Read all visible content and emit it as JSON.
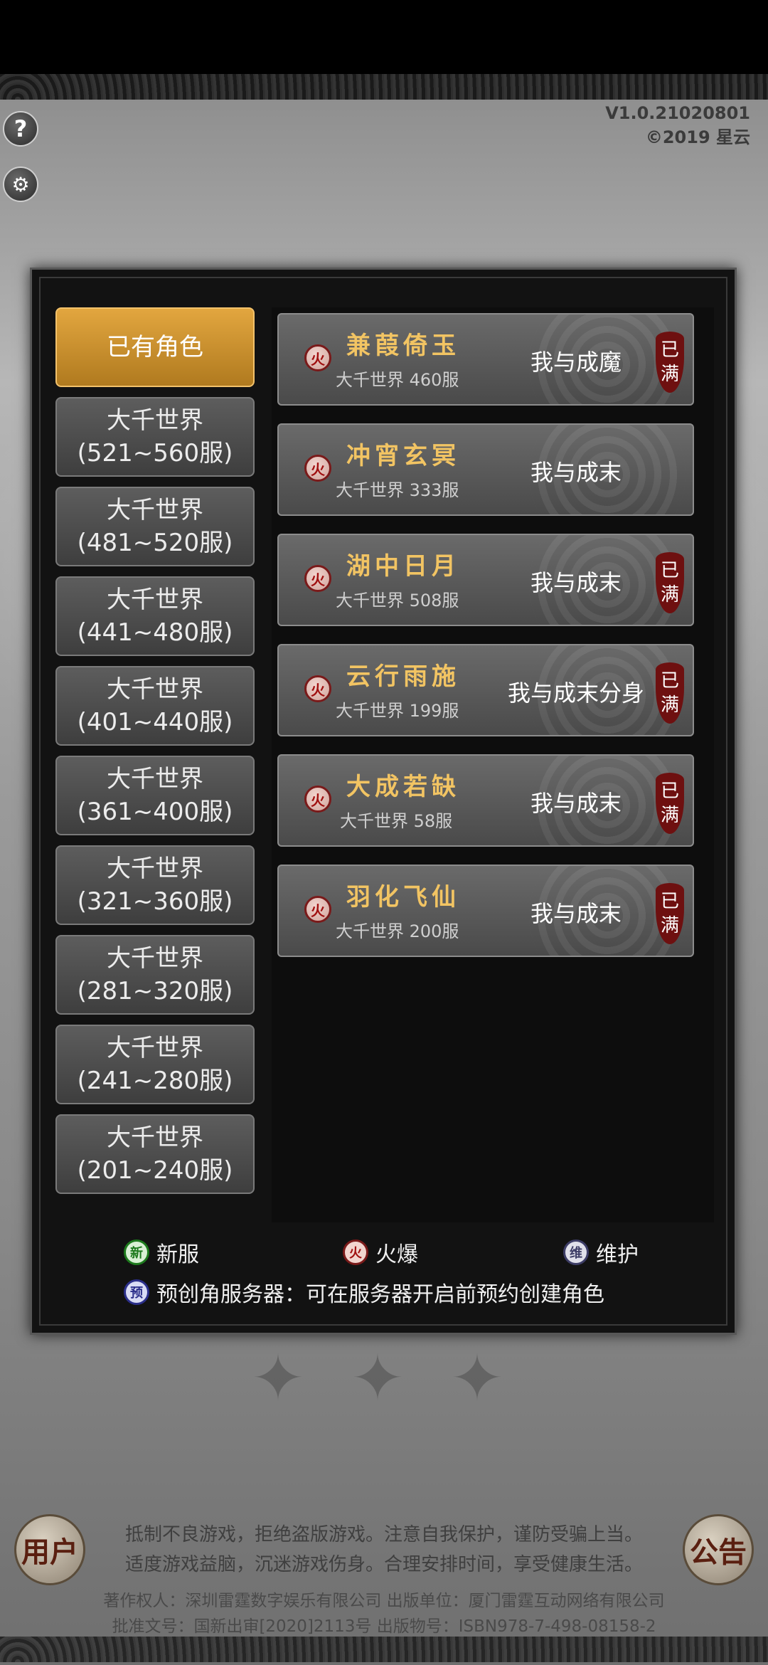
{
  "version": {
    "line1": "V1.0.21020801",
    "line2": "©2019 星云"
  },
  "icons": {
    "help": "?",
    "settings": "⚙"
  },
  "world_tabs": [
    {
      "line1": "已有角色",
      "line2": ""
    },
    {
      "line1": "大千世界",
      "line2": "(521~560服)"
    },
    {
      "line1": "大千世界",
      "line2": "(481~520服)"
    },
    {
      "line1": "大千世界",
      "line2": "(441~480服)"
    },
    {
      "line1": "大千世界",
      "line2": "(401~440服)"
    },
    {
      "line1": "大千世界",
      "line2": "(361~400服)"
    },
    {
      "line1": "大千世界",
      "line2": "(321~360服)"
    },
    {
      "line1": "大千世界",
      "line2": "(281~320服)"
    },
    {
      "line1": "大千世界",
      "line2": "(241~280服)"
    },
    {
      "line1": "大千世界",
      "line2": "(201~240服)"
    }
  ],
  "servers": [
    {
      "badge": "火",
      "name": "兼葭倚玉",
      "sub": "大千世界 460服",
      "role": "我与成魔",
      "full": [
        "已",
        "满"
      ]
    },
    {
      "badge": "火",
      "name": "冲宵玄冥",
      "sub": "大千世界 333服",
      "role": "我与成末",
      "full": []
    },
    {
      "badge": "火",
      "name": "湖中日月",
      "sub": "大千世界 508服",
      "role": "我与成末",
      "full": [
        "已",
        "满"
      ]
    },
    {
      "badge": "火",
      "name": "云行雨施",
      "sub": "大千世界 199服",
      "role": "我与成末分身",
      "full": [
        "已",
        "满"
      ]
    },
    {
      "badge": "火",
      "name": "大成若缺",
      "sub": "大千世界 58服",
      "role": "我与成末",
      "full": [
        "已",
        "满"
      ]
    },
    {
      "badge": "火",
      "name": "羽化飞仙",
      "sub": "大千世界 200服",
      "role": "我与成末",
      "full": [
        "已",
        "满"
      ]
    }
  ],
  "legend": {
    "new_badge": "新",
    "new_label": "新服",
    "hot_badge": "火",
    "hot_label": "火爆",
    "maint_badge": "维",
    "maint_label": "维护",
    "pre_badge": "预",
    "pre_label": "预创角服务器：可在服务器开启前预约创建角色"
  },
  "bottom": {
    "user_btn": "用户",
    "notice_btn": "公告",
    "notice_line1": "抵制不良游戏，拒绝盗版游戏。注意自我保护，谨防受骗上当。",
    "notice_line2": "适度游戏益脑，沉迷游戏伤身。合理安排时间，享受健康生活。",
    "copyright_line1": "著作权人：深圳雷霆数字娱乐有限公司 出版单位：厦门雷霆互动网络有限公司",
    "copyright_line2": "批准文号：国新出审[2020]2113号 出版物号：ISBN978-7-498-08158-2"
  }
}
